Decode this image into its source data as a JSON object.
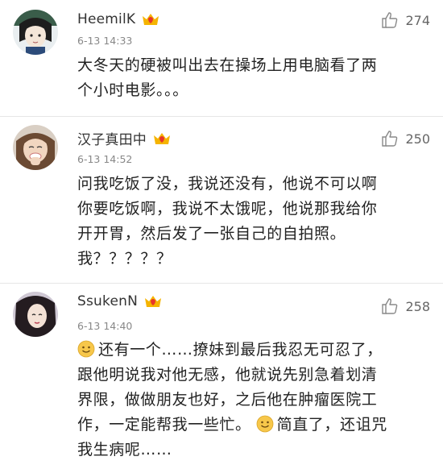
{
  "comments": [
    {
      "username": "HeemilK",
      "timestamp": "6-13 14:33",
      "likes": "274",
      "lines": [
        "大冬天的硬被叫出去在操场上用电脑看了两",
        "个小时电影。。。"
      ]
    },
    {
      "username": "汉子真田中",
      "timestamp": "6-13 14:52",
      "likes": "250",
      "lines": [
        "问我吃饭了没，我说还没有，他说不可以啊",
        "你要吃饭啊，我说不太饿呢，他说那我给你",
        "开开胃，然后发了一张自己的自拍照。",
        "我？？？？？"
      ]
    },
    {
      "username": "SsukenN",
      "timestamp": "6-13 14:40",
      "likes": "258",
      "lines": [
        "还有一个……撩妹到最后我忍无可忍了，",
        "跟他明说我对他无感，他就说先别急着划清",
        "界限，做做朋友也好，之后他在肿瘤医院工",
        "作，一定能帮我一些忙。",
        "简直了，还诅咒",
        "我生病呢……"
      ]
    }
  ],
  "icons": {
    "badge": "vip-crown-badge-icon",
    "like": "thumbs-up-icon",
    "emoji": "smiley-emoji-icon"
  },
  "colors": {
    "badge_yellow": "#f5b400",
    "badge_red": "#e8362a",
    "emoji_yellow": "#f7c74a"
  }
}
